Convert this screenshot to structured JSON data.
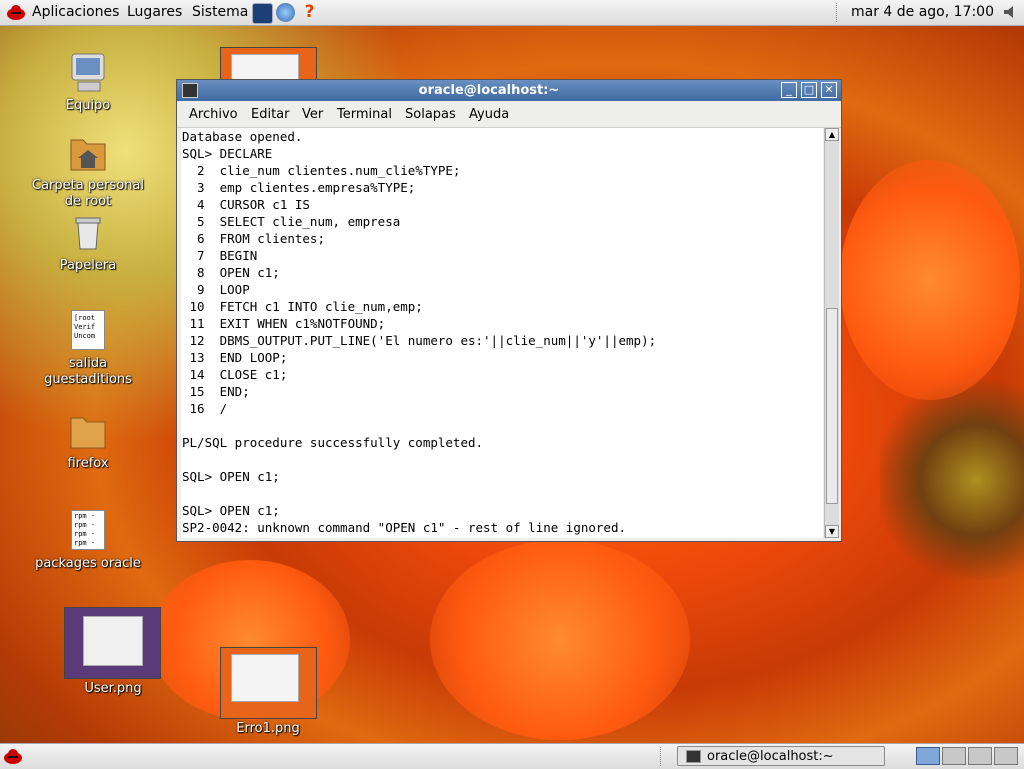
{
  "top_panel": {
    "menus": [
      "Aplicaciones",
      "Lugares",
      "Sistema"
    ],
    "clock": "mar  4 de ago, 17:00"
  },
  "desktop_icons": [
    {
      "label": "Equipo",
      "icon": "computer-icon"
    },
    {
      "label": "Carpeta personal de root",
      "icon": "home-folder-icon"
    },
    {
      "label": "Papelera",
      "icon": "trash-icon"
    },
    {
      "label": "salida guestaditions",
      "icon": "text-file-icon",
      "preview": [
        "[root",
        "Verif",
        "Uncom"
      ]
    },
    {
      "label": "firefox",
      "icon": "folder-icon"
    },
    {
      "label": "packages oracle",
      "icon": "text-file-icon",
      "preview": [
        "rpm -",
        "rpm -",
        "rpm -",
        "rpm -"
      ]
    },
    {
      "label": "User.png",
      "icon": "image-thumbnail"
    },
    {
      "label": "Erro1.png",
      "icon": "image-thumbnail"
    }
  ],
  "window": {
    "title": "oracle@localhost:~",
    "menu": [
      "Archivo",
      "Editar",
      "Ver",
      "Terminal",
      "Solapas",
      "Ayuda"
    ],
    "terminal_lines": [
      "Database opened.",
      "SQL> DECLARE",
      "  2  clie_num clientes.num_clie%TYPE;",
      "  3  emp clientes.empresa%TYPE;",
      "  4  CURSOR c1 IS",
      "  5  SELECT clie_num, empresa",
      "  6  FROM clientes;",
      "  7  BEGIN",
      "  8  OPEN c1;",
      "  9  LOOP",
      " 10  FETCH c1 INTO clie_num,emp;",
      " 11  EXIT WHEN c1%NOTFOUND;",
      " 12  DBMS_OUTPUT.PUT_LINE('El numero es:'||clie_num||'y'||emp);",
      " 13  END LOOP;",
      " 14  CLOSE c1;",
      " 15  END;",
      " 16  /",
      "",
      "PL/SQL procedure successfully completed.",
      "",
      "SQL> OPEN c1;",
      "",
      "SQL> OPEN c1;",
      "SP2-0042: unknown command \"OPEN c1\" - rest of line ignored."
    ]
  },
  "taskbar": {
    "task_label": "oracle@localhost:~",
    "workspaces": 4,
    "active_workspace": 1
  }
}
